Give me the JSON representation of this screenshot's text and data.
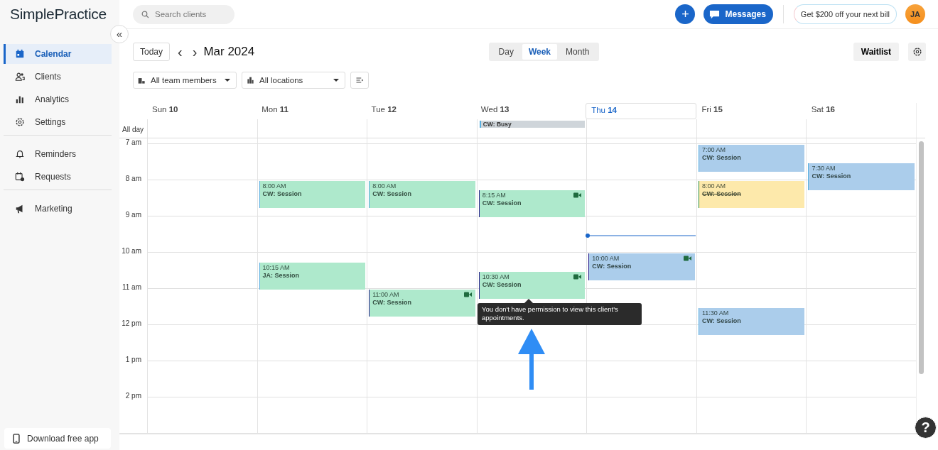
{
  "sidebar": {
    "logo": "SimplePractice",
    "collapse_icon": "«",
    "groups": [
      [
        {
          "label": "Calendar",
          "selected": true
        },
        {
          "label": "Clients",
          "selected": false
        },
        {
          "label": "Analytics",
          "selected": false
        },
        {
          "label": "Settings",
          "selected": false
        }
      ],
      [
        {
          "label": "Reminders",
          "selected": false
        },
        {
          "label": "Requests",
          "selected": false
        }
      ],
      [
        {
          "label": "Marketing",
          "selected": false
        }
      ]
    ],
    "download": "Download free app"
  },
  "topbar": {
    "search": {
      "placeholder": "Search clients"
    },
    "add": "+",
    "messages": "Messages",
    "promo": "Get $200 off your next bill",
    "avatar": "JA"
  },
  "toolbar": {
    "today": "Today",
    "prev": "‹",
    "next": "›",
    "title": "Mar 2024",
    "views": [
      {
        "label": "Day",
        "selected": false
      },
      {
        "label": "Week",
        "selected": true
      },
      {
        "label": "Month",
        "selected": false
      }
    ],
    "waitlist": "Waitlist"
  },
  "filters": [
    {
      "kind": "team",
      "label": "All team members"
    },
    {
      "kind": "location",
      "label": "All locations"
    }
  ],
  "calendar": {
    "all_day_label": "All day",
    "hours": [
      "7 am",
      "8 am",
      "9 am",
      "10 am",
      "11 am",
      "12 pm",
      "1 pm",
      "2 pm"
    ],
    "days": [
      {
        "weekday": "Sun",
        "date": "10",
        "today": false
      },
      {
        "weekday": "Mon",
        "date": "11",
        "today": false,
        "events": [
          {
            "time": "8:00 AM",
            "title": "CW: Session",
            "color": "#aee9cc",
            "video": false,
            "cancelled": false
          },
          {
            "time": "10:15 AM",
            "title": "JA: Session",
            "color": "#aee9cc",
            "video": false,
            "cancelled": false
          }
        ]
      },
      {
        "weekday": "Tue",
        "date": "12",
        "today": false,
        "events": [
          {
            "time": "8:00 AM",
            "title": "CW: Session",
            "color": "#aee9cc",
            "video": false,
            "cancelled": false
          },
          {
            "time": "11:00 AM",
            "title": "CW: Session",
            "color": "#aee9cc",
            "video": true,
            "cancelled": false
          }
        ]
      },
      {
        "weekday": "Wed",
        "date": "13",
        "today": false,
        "all_day": [
          {
            "title": "CW: Busy"
          }
        ],
        "events": [
          {
            "time": "8:15 AM",
            "title": "CW: Session",
            "color": "#aee9cc",
            "video": true,
            "cancelled": false
          },
          {
            "time": "10:30 AM",
            "title": "CW: Session",
            "color": "#aee9cc",
            "video": true,
            "cancelled": false
          }
        ]
      },
      {
        "weekday": "Thu",
        "date": "14",
        "today": true,
        "events": [
          {
            "time": "10:00 AM",
            "title": "CW: Session",
            "color": "#abcdeb",
            "video": true,
            "cancelled": false
          }
        ]
      },
      {
        "weekday": "Fri",
        "date": "15",
        "today": false,
        "events": [
          {
            "time": "7:00 AM",
            "title": "CW: Session",
            "color": "#abcdeb",
            "video": false,
            "cancelled": false
          },
          {
            "time": "8:00 AM",
            "title": "CW: Session",
            "color": "#fde9ab",
            "video": false,
            "cancelled": true
          },
          {
            "time": "11:30 AM",
            "title": "CW: Session",
            "color": "#abcdeb",
            "video": false,
            "cancelled": false
          }
        ]
      },
      {
        "weekday": "Sat",
        "date": "16",
        "today": false,
        "events": [
          {
            "time": "7:30 AM",
            "title": "CW: Session",
            "color": "#abcdeb",
            "video": false,
            "cancelled": false
          }
        ]
      }
    ]
  },
  "tooltip": "You don't have permission to view this client's appointments.",
  "help": "?"
}
